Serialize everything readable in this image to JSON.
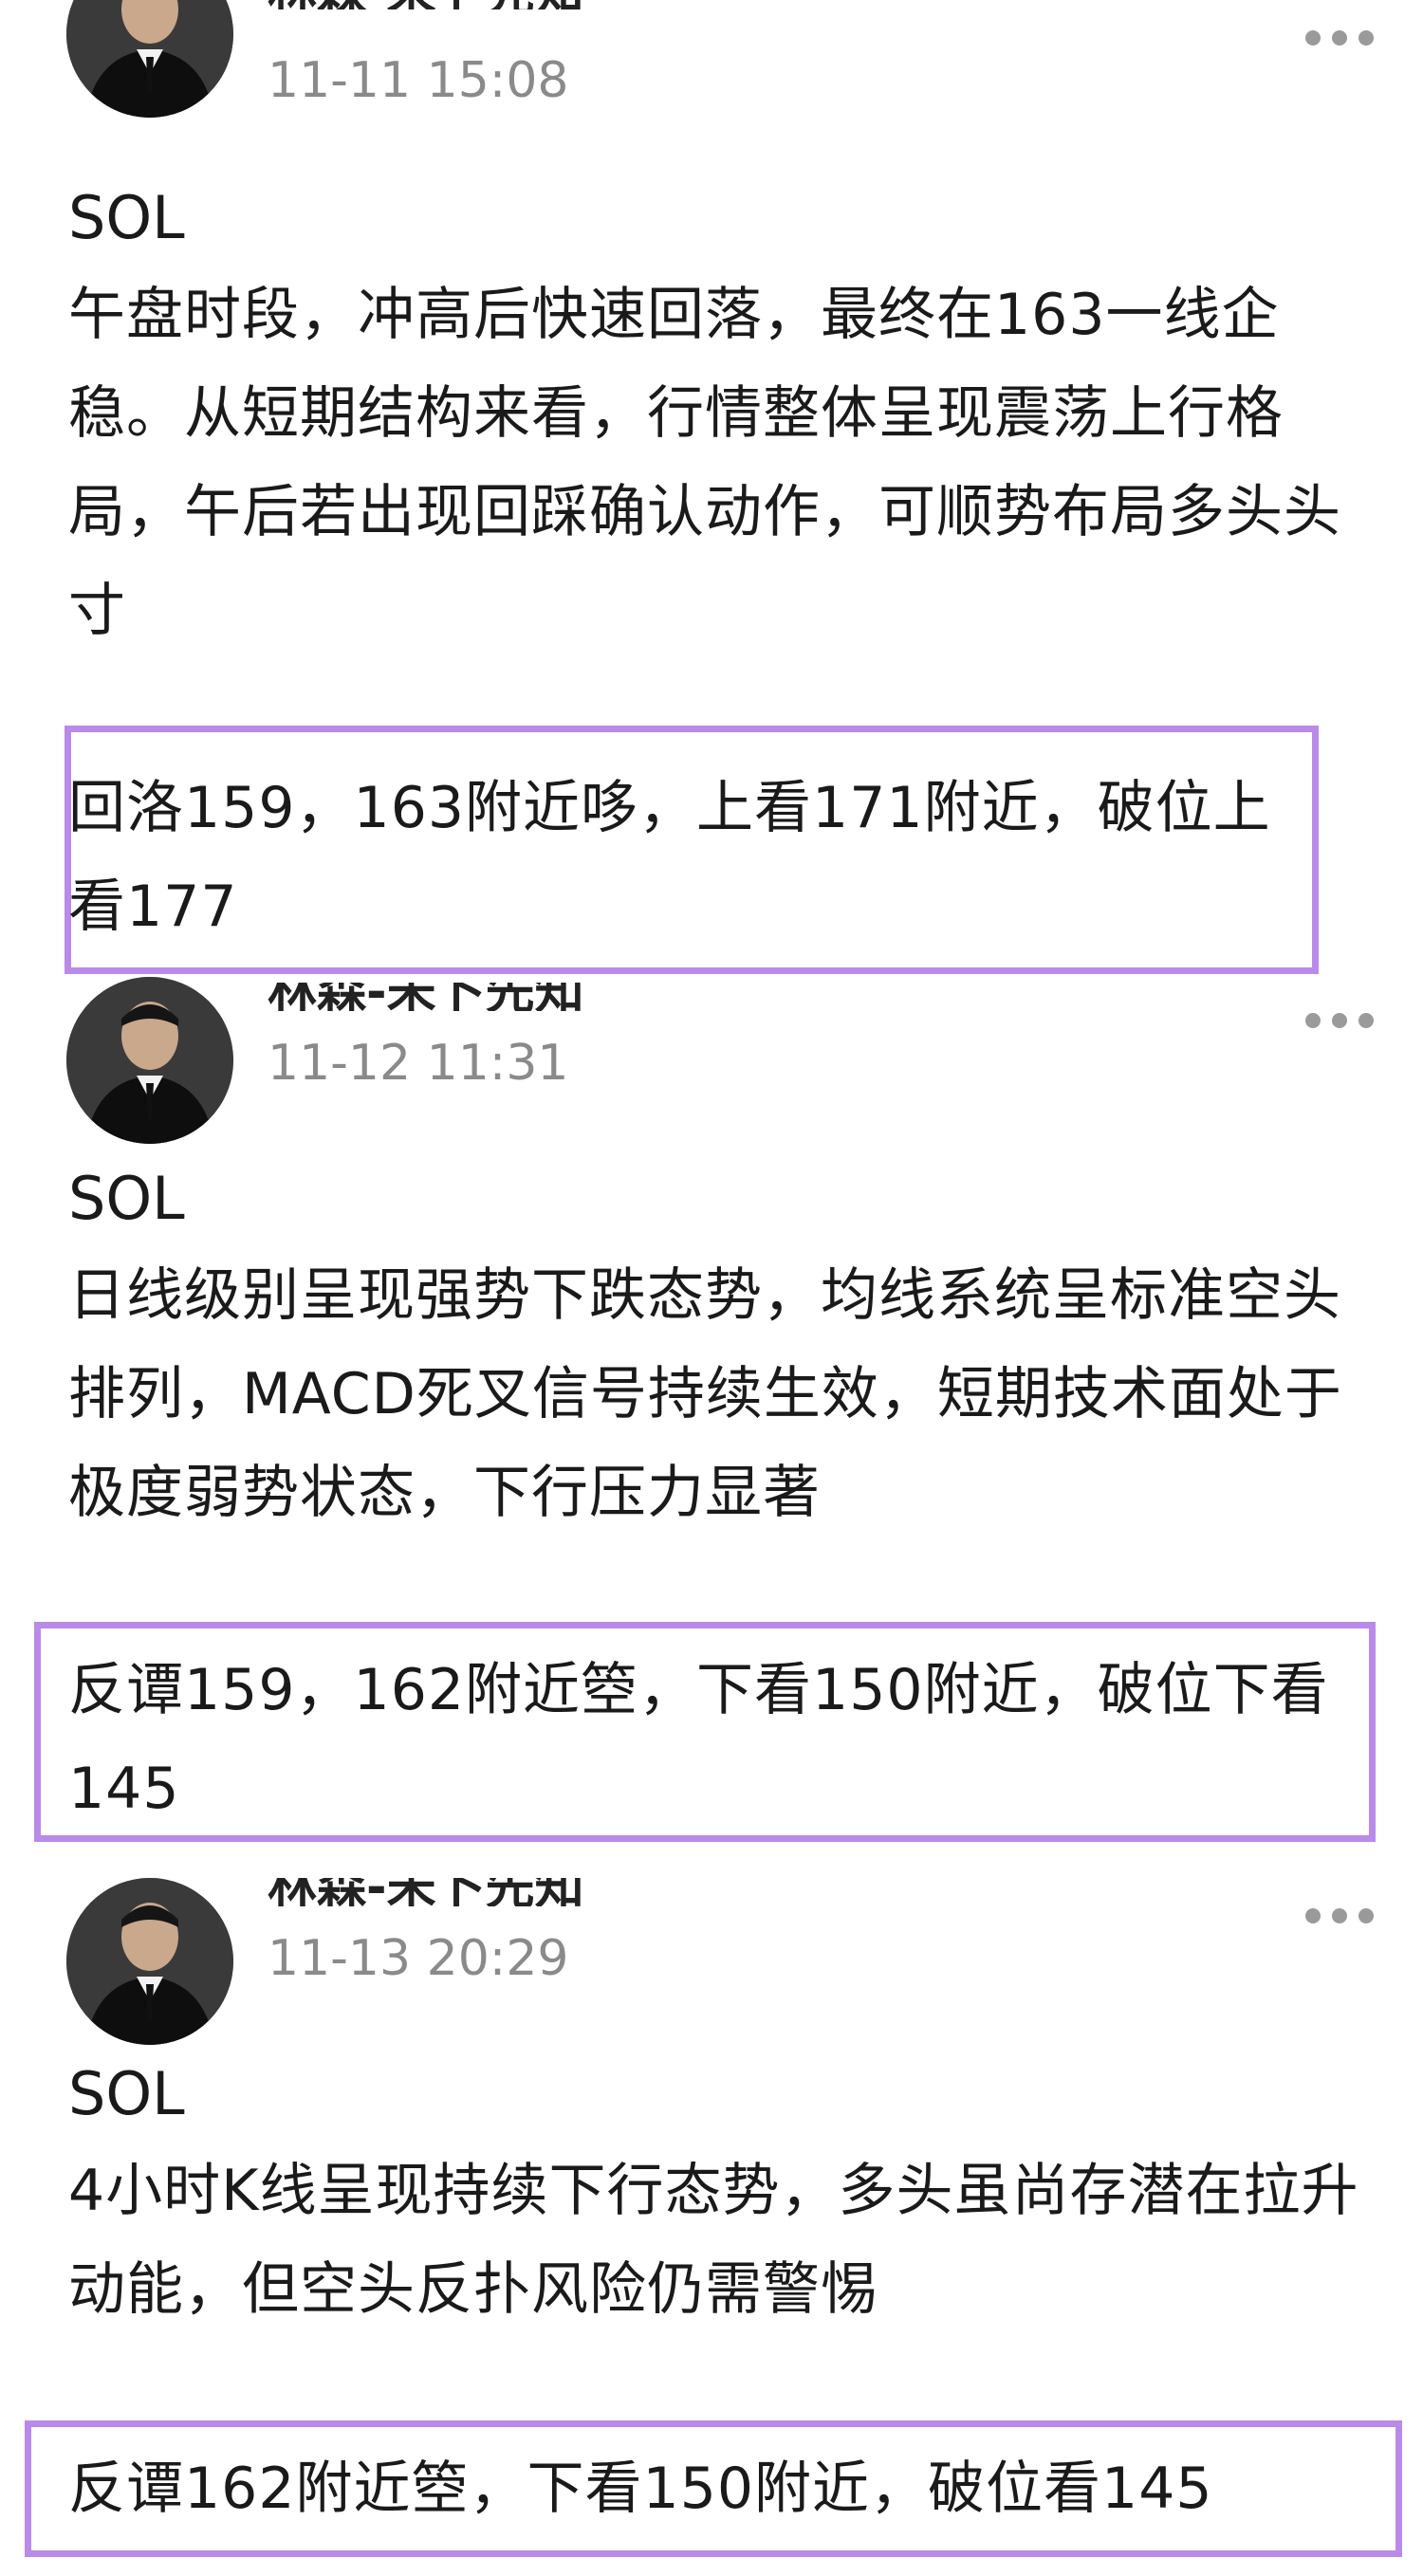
{
  "posts": [
    {
      "author": "林森-未卜先知",
      "time": "11-11 15:08",
      "symbol": "SOL",
      "body": "午盘时段，冲高后快速回落，最终在163一线企稳。从短期结构来看，行情整体呈现震荡上行格局，午后若出现回踩确认动作，可顺势布局多头头寸",
      "strategy": "回洛159，163附近哆，上看171附近，破位上看177"
    },
    {
      "author": "林森-未卜先知",
      "time": "11-12 11:31",
      "symbol": "SOL",
      "body": "日线级别呈现强势下跌态势，均线系统呈标准空头排列，MACD死叉信号持续生效，短期技术面处于极度弱势状态，下行压力显著",
      "strategy": "反谭159，162附近箜，下看150附近，破位下看145"
    },
    {
      "author": "林森-未卜先知",
      "time": "11-13 20:29",
      "symbol": "SOL",
      "body": "4小时K线呈现持续下行态势，多头虽尚存潜在拉升动能，但空头反扑风险仍需警惕",
      "strategy": "反谭162附近箜，下看150附近，破位看145"
    }
  ],
  "colors": {
    "highlight_border": "#b98ae8",
    "timestamp": "#8a8a8a",
    "text": "#1a1a1a"
  },
  "icons": {
    "more": "more-horizontal-icon"
  }
}
